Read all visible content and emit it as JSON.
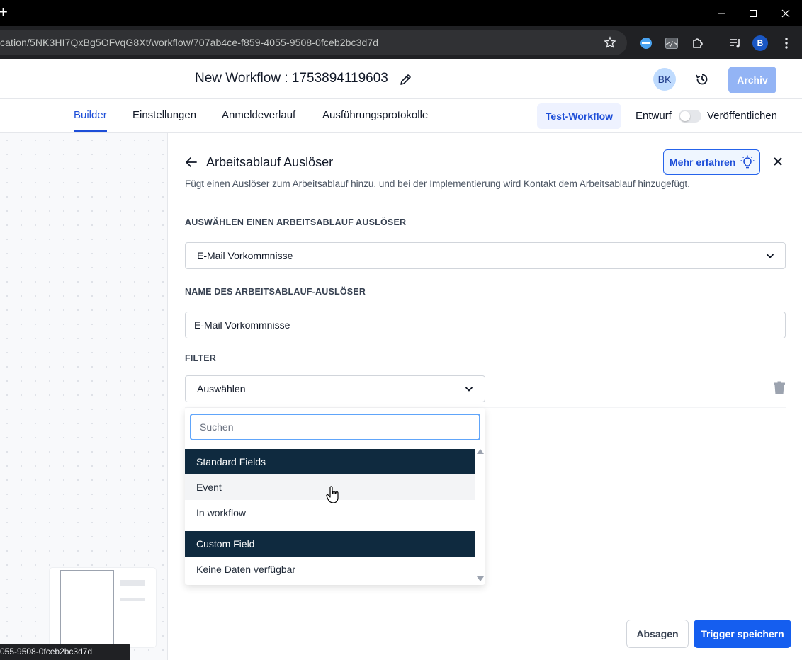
{
  "browser": {
    "new_tab_glyph": "+",
    "url": "cation/5NK3HI7QxBg5OFvqG8Xt/workflow/707ab4ce-f859-4055-9508-0fceb2bc3d7d",
    "profile_initial": "B",
    "status_url": "055-9508-0fceb2bc3d7d",
    "icons": [
      "minimize-icon",
      "maximize-icon",
      "close-window-icon",
      "bookmark-star-icon",
      "extension-icon",
      "devtools-icon",
      "puzzle-icon",
      "media-icon"
    ]
  },
  "header": {
    "workflow_title": "New Workflow : 1753894119603",
    "avatar_initials": "BK",
    "archive_label": "Archiv"
  },
  "tabs": [
    {
      "label": "Builder",
      "active": true
    },
    {
      "label": "Einstellungen",
      "active": false
    },
    {
      "label": "Anmeldeverlauf",
      "active": false
    },
    {
      "label": "Ausführungsprotokolle",
      "active": false
    }
  ],
  "toolbar": {
    "test_label": "Test-Workflow",
    "draft_label": "Entwurf",
    "publish_label": "Veröffentlichen",
    "publish_toggle_on": false
  },
  "panel": {
    "title": "Arbeitsablauf Auslöser",
    "learn_more": "Mehr erfahren",
    "description": "Fügt einen Auslöser zum Arbeitsablauf hinzu, und bei der Implementierung wird Kontakt dem Arbeitsablauf hinzugefügt.",
    "trigger_section_label": "AUSWÄHLEN EINEN ARBEITSABLAUF AUSLÖSER",
    "trigger_value": "E-Mail Vorkommnisse",
    "name_section_label": "NAME DES ARBEITSABLAUF-AUSLÖSER",
    "name_value": "E-Mail Vorkommnisse",
    "filter_section_label": "FILTER",
    "filter_select_value": "Auswählen",
    "cancel_label": "Absagen",
    "save_label": "Trigger speichern"
  },
  "dropdown": {
    "search_placeholder": "Suchen",
    "groups": [
      {
        "header": "Standard Fields",
        "options": [
          "Event",
          "In workflow"
        ]
      },
      {
        "header": "Custom Field",
        "options": [
          "Keine Daten verfügbar"
        ]
      }
    ],
    "hovered_option": "Event"
  },
  "colors": {
    "accent": "#1d4ed8",
    "primary_button": "#155eef",
    "group_header": "#0f2a3f",
    "archive_button": "#93b4f5"
  }
}
